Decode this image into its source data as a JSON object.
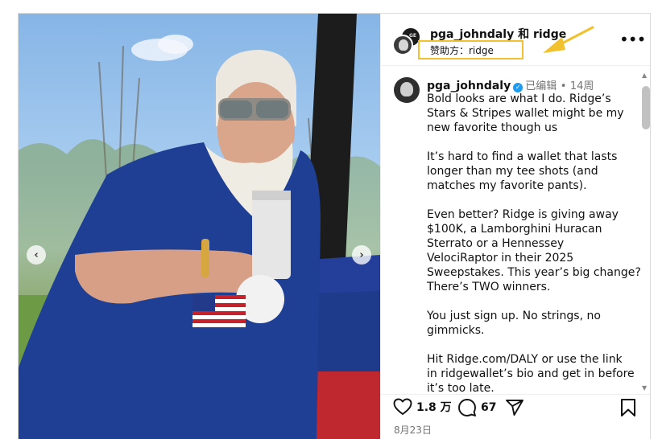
{
  "header": {
    "title": "pga_johndaly 和 ridge",
    "sponsor": "赞助方：ridge",
    "avatar_back_text": "GE"
  },
  "caption": {
    "username": "pga_johndaly",
    "edited": "已编辑",
    "separator": "•",
    "age": "14周",
    "paragraphs": [
      "Bold looks are what I do. Ridge’s\nStars & Stripes wallet might be my\nnew favorite though us",
      "It’s hard to find a wallet that lasts\nlonger than my tee shots (and\nmatches my favorite pants).",
      "Even better? Ridge is giving away\n$100K, a Lamborghini Huracan\nSterrato or a Hennessey\nVelociRaptor in their 2025\nSweepstakes. This year’s big change?\nThere’s TWO winners.",
      "You just sign up. No strings, no\ngimmicks.",
      "Hit Ridge.com/DALY or use the link\nin ridgewallet’s bio and get in before\nit’s too late."
    ]
  },
  "actions": {
    "likes": "1.8 万",
    "comments": "67"
  },
  "date": "8月23日",
  "icons": {
    "more": "more-options-icon",
    "verified": "verified-badge-icon",
    "like": "heart-icon",
    "comment": "comment-icon",
    "share": "send-icon",
    "save": "bookmark-icon",
    "prev": "chevron-left-icon",
    "next": "chevron-right-icon"
  },
  "colors": {
    "annotation": "#f2c12e",
    "verified": "#1d9bf0",
    "muted": "#737373"
  }
}
